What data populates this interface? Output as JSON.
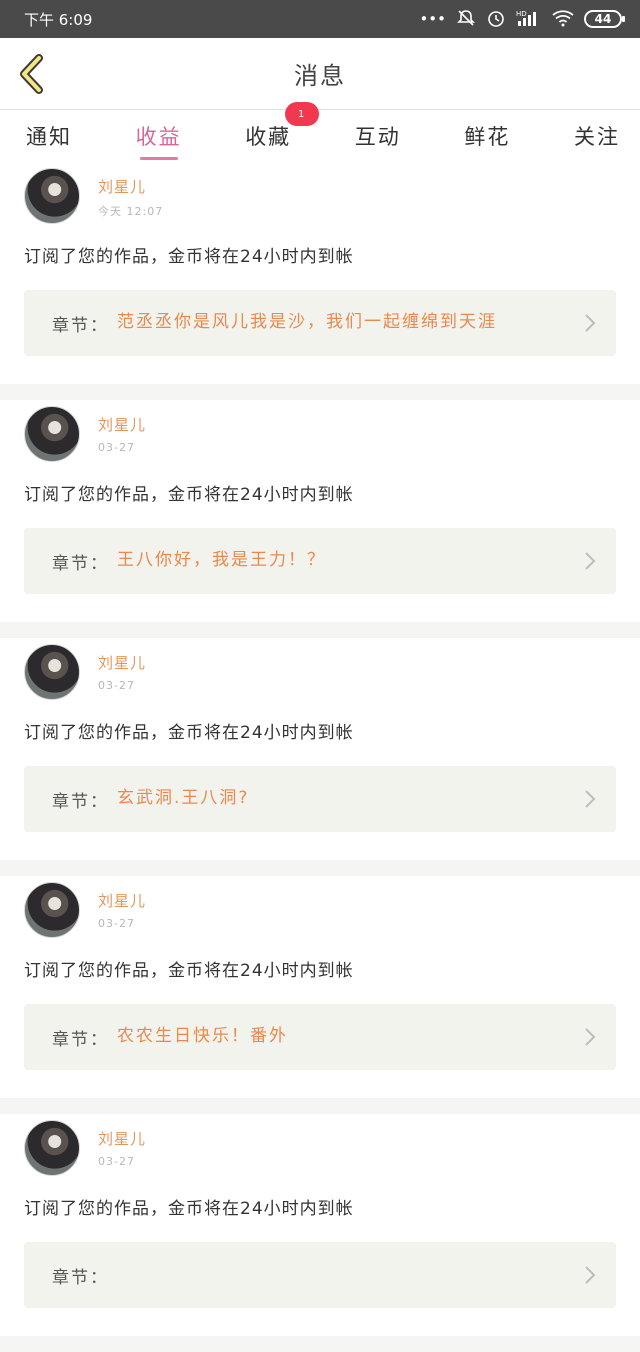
{
  "status_bar": {
    "time": "下午 6:09",
    "icons": [
      "more-dots-icon",
      "mute-bell-icon",
      "alarm-icon",
      "signal-icon",
      "wifi-icon"
    ],
    "hd_label": "HD",
    "battery": "44"
  },
  "header": {
    "title": "消息",
    "back_icon": "chevron-left-icon"
  },
  "tabs": [
    {
      "label": "通知"
    },
    {
      "label": "收益",
      "active": true
    },
    {
      "label": "收藏",
      "badge": "1"
    },
    {
      "label": "互动"
    },
    {
      "label": "鲜花"
    },
    {
      "label": "关注"
    }
  ],
  "messages": [
    {
      "username": "刘星儿",
      "time": "今天 12:07",
      "text": "订阅了您的作品，金币将在24小时内到帐",
      "chapter_label": "章节：",
      "chapter_title": "范丞丞你是风儿我是沙，我们一起缠绵到天涯"
    },
    {
      "username": "刘星儿",
      "time": "03-27",
      "text": "订阅了您的作品，金币将在24小时内到帐",
      "chapter_label": "章节：",
      "chapter_title": "王八你好，我是王力！？"
    },
    {
      "username": "刘星儿",
      "time": "03-27",
      "text": "订阅了您的作品，金币将在24小时内到帐",
      "chapter_label": "章节：",
      "chapter_title": "玄武洞.王八洞?"
    },
    {
      "username": "刘星儿",
      "time": "03-27",
      "text": "订阅了您的作品，金币将在24小时内到帐",
      "chapter_label": "章节：",
      "chapter_title": "农农生日快乐！番外"
    },
    {
      "username": "刘星儿",
      "time": "03-27",
      "text": "订阅了您的作品，金币将在24小时内到帐",
      "chapter_label": "章节：",
      "chapter_title": ""
    }
  ],
  "colors": {
    "accent_pink": "#d9669a",
    "username_orange": "#e0985f",
    "chapter_orange": "#e8894f",
    "badge_red": "#f2374f",
    "chapter_bg": "#f3f3ed"
  }
}
